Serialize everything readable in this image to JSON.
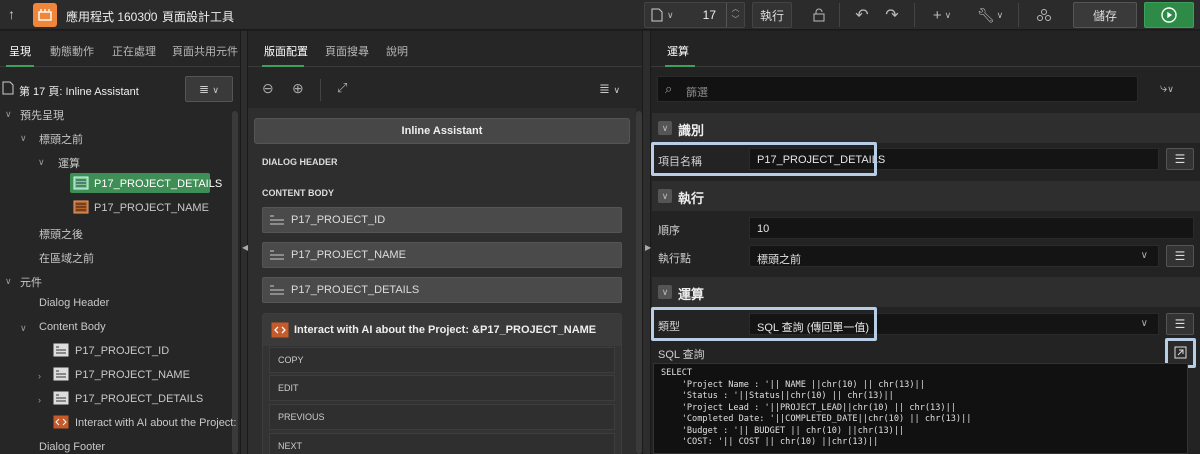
{
  "topbar": {
    "up_icon": "up-arrow-icon",
    "app_title": "應用程式 160300",
    "separator": "\\",
    "page": "頁面設計工具",
    "page_number": "17",
    "exec_label": "執行",
    "save_label": "儲存"
  },
  "left": {
    "tabs": [
      "呈現",
      "動態動作",
      "正在處理",
      "頁面共用元件"
    ],
    "page_title": "第 17 頁: Inline Assistant",
    "tree": {
      "pre_render": "預先呈現",
      "before_header": "標頭之前",
      "computations": "運算",
      "comp1": "P17_PROJECT_DETAILS",
      "comp2": "P17_PROJECT_NAME",
      "after_header": "標頭之後",
      "before_regions": "在區域之前",
      "components": "元件",
      "dialog_header": "Dialog Header",
      "content_body": "Content Body",
      "item1": "P17_PROJECT_ID",
      "item2": "P17_PROJECT_NAME",
      "item3": "P17_PROJECT_DETAILS",
      "item4": "Interact with AI about the Project: &",
      "dialog_footer": "Dialog Footer"
    }
  },
  "middle": {
    "tabs": [
      "版面配置",
      "頁面搜尋",
      "說明"
    ],
    "header_title": "Inline Assistant",
    "dialog_header": "DIALOG HEADER",
    "content_body": "CONTENT BODY",
    "items": [
      "P17_PROJECT_ID",
      "P17_PROJECT_NAME",
      "P17_PROJECT_DETAILS"
    ],
    "ai_region": "Interact with AI about the Project: &P17_PROJECT_NAME",
    "buttons": [
      "COPY",
      "EDIT",
      "PREVIOUS",
      "NEXT"
    ]
  },
  "right": {
    "tab": "運算",
    "filter_placeholder": "篩選",
    "sections": {
      "identification": "識別",
      "execution": "執行",
      "computation": "運算"
    },
    "item_name_label": "項目名稱",
    "item_name_value": "P17_PROJECT_DETAILS",
    "sequence_label": "順序",
    "sequence_value": "10",
    "point_label": "執行點",
    "point_value": "標頭之前",
    "type_label": "類型",
    "type_value": "SQL 查詢 (傳回單一值)",
    "sql_label": "SQL 查詢",
    "sql_lines": [
      "SELECT",
      "    'Project Name : '|| NAME ||chr(10) || chr(13)||",
      "    'Status : '||Status||chr(10) || chr(13)||",
      "    'Project Lead : '||PROJECT_LEAD||chr(10) || chr(13)||",
      "    'Completed Date: '||COMPLETED_DATE||chr(10) || chr(13)||",
      "    'Budget : '|| BUDGET || chr(10) ||chr(13)||",
      "    'COST: '|| COST || chr(10) ||chr(13)||"
    ]
  },
  "colors": {
    "accent_green": "#3da15b",
    "app_orange": "#f0863a",
    "highlight": "#b8cde6"
  }
}
